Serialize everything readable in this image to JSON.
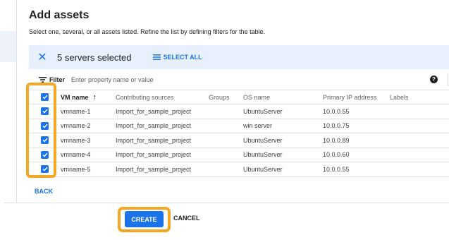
{
  "dialog": {
    "title": "Add assets",
    "subtitle": "Select one, several, or all assets listed. Refine the list by defining filters for the table."
  },
  "selection": {
    "close_icon": "close-icon",
    "count_label": "5 servers selected",
    "select_all_label": "SELECT ALL",
    "select_all_icon": "list-icon"
  },
  "filter": {
    "label": "Filter",
    "placeholder": "Enter property name or value",
    "filter_icon": "filter-icon",
    "help_icon": "help-icon"
  },
  "table": {
    "columns": [
      "VM name",
      "Contributing sources",
      "Groups",
      "OS name",
      "Primary IP address",
      "Labels"
    ],
    "sort_icon": "arrow-up-icon",
    "rows": [
      {
        "vm": "vmname-1",
        "source": "Import_for_sample_project",
        "groups": "",
        "os": "UbuntuServer",
        "ip": "10.0.0.55",
        "labels": "",
        "checked": true
      },
      {
        "vm": "vmname-2",
        "source": "Import_for_sample_project",
        "groups": "",
        "os": "win server",
        "ip": "10.0.0.75",
        "labels": "",
        "checked": true
      },
      {
        "vm": "vmname-3",
        "source": "Import_for_sample_project",
        "groups": "",
        "os": "UbuntuServer",
        "ip": "10.0.0.89",
        "labels": "",
        "checked": true
      },
      {
        "vm": "vmname-4",
        "source": "Import_for_sample_project",
        "groups": "",
        "os": "UbuntuServer",
        "ip": "10.0.0.60",
        "labels": "",
        "checked": true
      },
      {
        "vm": "vmname-5",
        "source": "Import_for_sample_project",
        "groups": "",
        "os": "UbuntuServer",
        "ip": "10.0.0.55",
        "labels": "",
        "checked": true
      }
    ]
  },
  "actions": {
    "back_label": "BACK",
    "create_label": "CREATE",
    "cancel_label": "CANCEL"
  },
  "colors": {
    "accent": "#1a73e8",
    "highlight": "#f5a623",
    "selection_bg": "#e8f0fe"
  }
}
